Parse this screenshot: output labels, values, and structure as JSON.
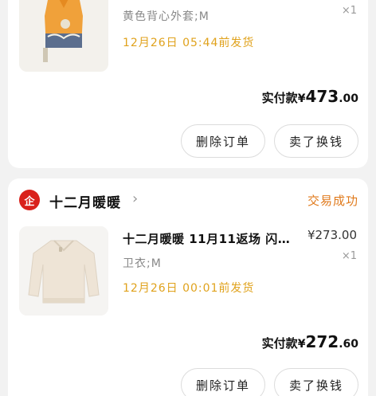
{
  "orders": [
    {
      "item": {
        "spec": "黄色背心外套;M",
        "ship_note": "12月26日 05:44前发货",
        "qty": "×1"
      },
      "paid": {
        "label": "实付款",
        "yen": "¥",
        "int": "473",
        "dec": ".00"
      },
      "actions": {
        "delete_label": "删除订单",
        "resell_label": "卖了换钱"
      }
    },
    {
      "shop": {
        "logo_text": "企",
        "name": "十二月暖暖",
        "chevron": "›"
      },
      "status": "交易成功",
      "item": {
        "title": "十二月暖暖 11月11返场 闪…",
        "price": "¥273.00",
        "spec": "卫衣;M",
        "ship_note": "12月26日 00:01前发货",
        "qty": "×1"
      },
      "paid": {
        "label": "实付款",
        "yen": "¥",
        "int": "272",
        "dec": ".60"
      },
      "actions": {
        "delete_label": "删除订单",
        "resell_label": "卖了换钱"
      }
    }
  ],
  "colors": {
    "accent_ship": "#e0a21c",
    "status": "#e07a1c",
    "shop_logo": "#d9211b"
  }
}
